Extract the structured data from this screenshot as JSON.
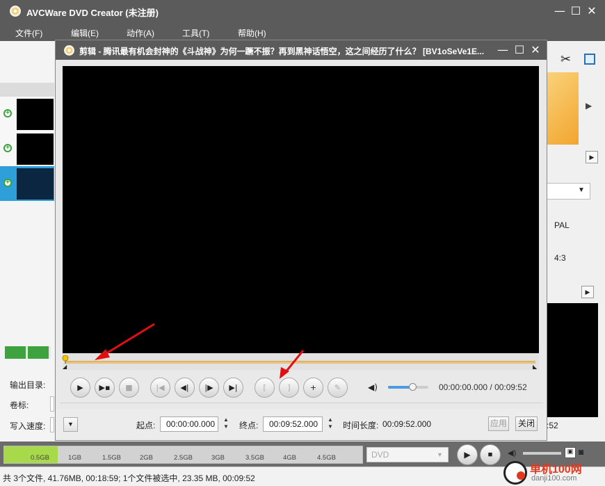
{
  "main_window": {
    "title": "AVCWare DVD Creator (未注册)",
    "minimize": "—",
    "maximize": "☐",
    "close": "✕"
  },
  "menu": [
    "文件(F)",
    "编辑(E)",
    "动作(A)",
    "工具(T)",
    "帮助(H)"
  ],
  "left_panel": {
    "output_dir_label": "输出目录:",
    "volume_label": "卷标:",
    "write_speed_label": "写入速度:"
  },
  "right_panel": {
    "pal": "PAL",
    "aspect": "4:3",
    "time_tail": ":52"
  },
  "dialog": {
    "title": "剪辑 - 腾讯最有机会封神的《斗战神》为何一蹶不振？再到黑神话悟空，这之间经历了什么？ [BV1oSeVe1E...",
    "time_display": "00:00:00.000 / 00:09:52",
    "start_label": "起点:",
    "start_value": "00:00:00.000",
    "end_label": "终点:",
    "end_value": "00:09:52.000",
    "duration_label": "时间长度:",
    "duration_value": "00:09:52.000",
    "apply_label": "应用",
    "close_label": "关闭",
    "seek_position": 0,
    "volume_level": 0.6
  },
  "disk_bar": {
    "ticks": [
      "0.5GB",
      "1GB",
      "1.5GB",
      "2GB",
      "2.5GB",
      "3GB",
      "3.5GB",
      "4GB",
      "4.5GB"
    ],
    "used_fraction": 0.15,
    "format": "DVD"
  },
  "status": {
    "text": "共 3个文件, 41.76MB, 00:18:59; 1个文件被选中, 23.35 MB, 00:09:52"
  },
  "watermark": {
    "name": "单机100网",
    "url": "danji100.com"
  },
  "colors": {
    "titlebar": "#5b5b5b",
    "seek_track": "#e8c27a",
    "disk_fill": "#a8d94a",
    "selected_row": "#2e9fd8",
    "arrow": "#e01010"
  }
}
